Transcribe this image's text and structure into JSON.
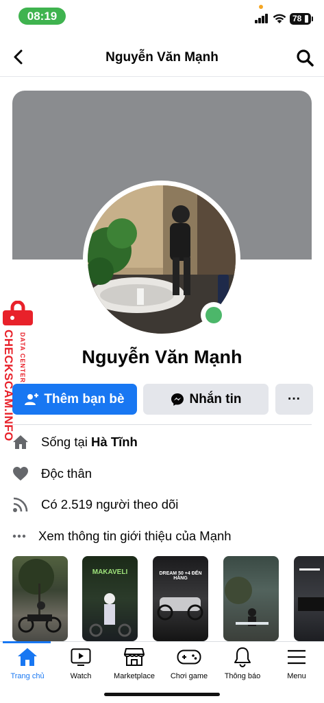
{
  "status_bar": {
    "time": "08:19",
    "battery": "78"
  },
  "header": {
    "title": "Nguyễn Văn Mạnh"
  },
  "profile": {
    "name": "Nguyễn Văn Mạnh",
    "online": true
  },
  "actions": {
    "add_friend_label": "Thêm bạn bè",
    "message_label": "Nhắn tin",
    "more_label": "···"
  },
  "info": {
    "lives_prefix": "Sống tại ",
    "lives_place": "Hà Tĩnh",
    "relationship": "Độc thân",
    "followers": "Có 2.519 người theo dõi",
    "see_more": "Xem thông tin giới thiệu của Mạnh"
  },
  "stories": [
    {
      "text": ""
    },
    {
      "text": "MAKAVELI"
    },
    {
      "text": "DREAM 50 +4 ĐẾN HẰNG"
    },
    {
      "text": ""
    },
    {
      "text": ""
    }
  ],
  "tabs": [
    {
      "label": "Trang chủ",
      "icon": "home-icon",
      "active": true
    },
    {
      "label": "Watch",
      "icon": "watch-icon"
    },
    {
      "label": "Marketplace",
      "icon": "marketplace-icon"
    },
    {
      "label": "Chơi game",
      "icon": "gamepad-icon"
    },
    {
      "label": "Thông báo",
      "icon": "bell-icon"
    },
    {
      "label": "Menu",
      "icon": "menu-icon"
    }
  ],
  "watermark": {
    "brand": "CHECKSCAM.INFO",
    "sub": "DATA CENTER"
  },
  "colors": {
    "accent": "#1877f2",
    "online": "#4cb76a",
    "cover": "#8a8c8f",
    "watermark": "#e8212a"
  }
}
